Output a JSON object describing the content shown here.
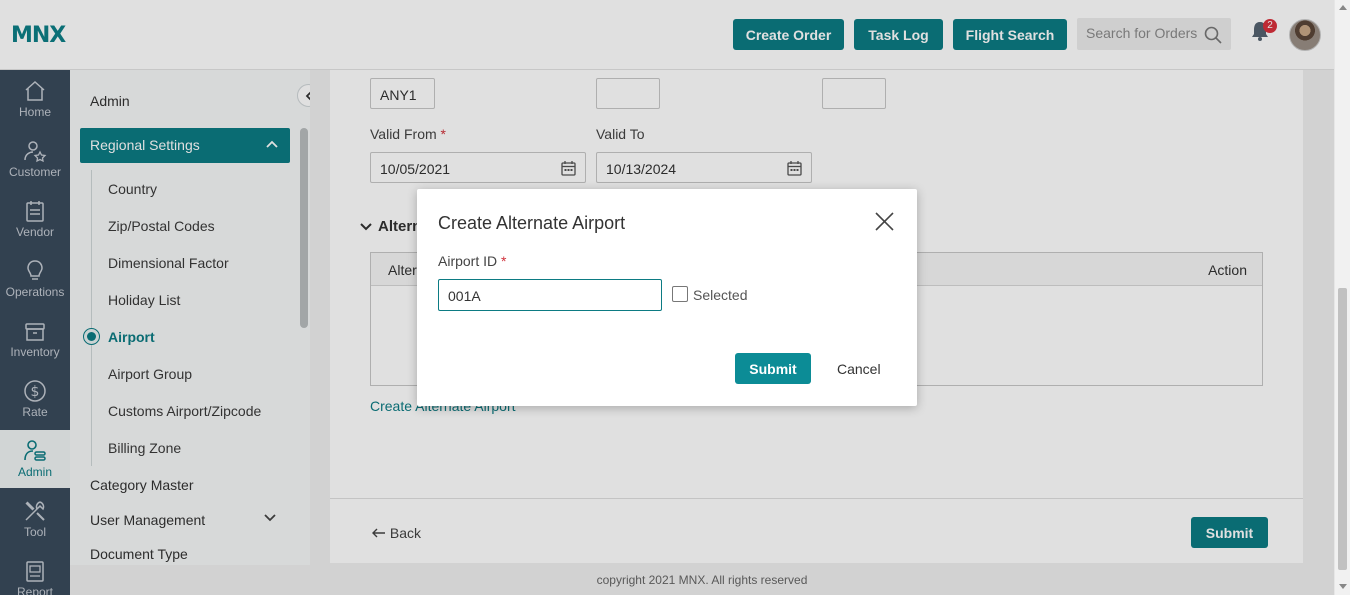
{
  "header": {
    "logo": "MNX",
    "buttons": [
      "Create Order",
      "Task Log",
      "Flight Search"
    ],
    "search_placeholder": "Search for Orders",
    "notification_count": "2"
  },
  "leftnav": [
    {
      "label": "Home",
      "icon": "home-icon"
    },
    {
      "label": "Customer",
      "icon": "customer-icon"
    },
    {
      "label": "Vendor",
      "icon": "vendor-icon"
    },
    {
      "label": "Operations",
      "icon": "lightbulb-icon"
    },
    {
      "label": "Inventory",
      "icon": "inventory-icon"
    },
    {
      "label": "Rate",
      "icon": "dollar-icon"
    },
    {
      "label": "Admin",
      "icon": "admin-icon",
      "active": true
    },
    {
      "label": "Tool",
      "icon": "tool-icon"
    },
    {
      "label": "Report",
      "icon": "report-icon"
    }
  ],
  "submenu": {
    "title": "Admin",
    "group": "Regional Settings",
    "items": [
      "Country",
      "Zip/Postal Codes",
      "Dimensional Factor",
      "Holiday List",
      "Airport",
      "Airport Group",
      "Customs Airport/Zipcode",
      "Billing Zone"
    ],
    "active_item": "Airport",
    "other": [
      "Category Master",
      "User Management",
      "Document Type"
    ]
  },
  "form": {
    "top_field_1": "ANY1",
    "top_field_2": "",
    "top_field_3": "",
    "valid_from_label": "Valid From",
    "valid_from_value": "10/05/2021",
    "valid_to_label": "Valid To",
    "valid_to_value": "10/13/2024",
    "alt_section_title": "Altern",
    "alt_col_1": "Alter",
    "alt_col_2": "Action",
    "create_alt_link": "Create Alternate Airport",
    "back": "Back",
    "submit": "Submit"
  },
  "footer": {
    "copyright": "copyright 2021 MNX. All rights reserved"
  },
  "modal": {
    "title": "Create Alternate Airport",
    "airport_id_label": "Airport ID",
    "airport_id_value": "001A",
    "selected_label": "Selected",
    "submit": "Submit",
    "cancel": "Cancel"
  },
  "colors": {
    "accent": "#0c7b83",
    "nav_bg": "#3a4a5c",
    "badge": "#d9303c"
  }
}
